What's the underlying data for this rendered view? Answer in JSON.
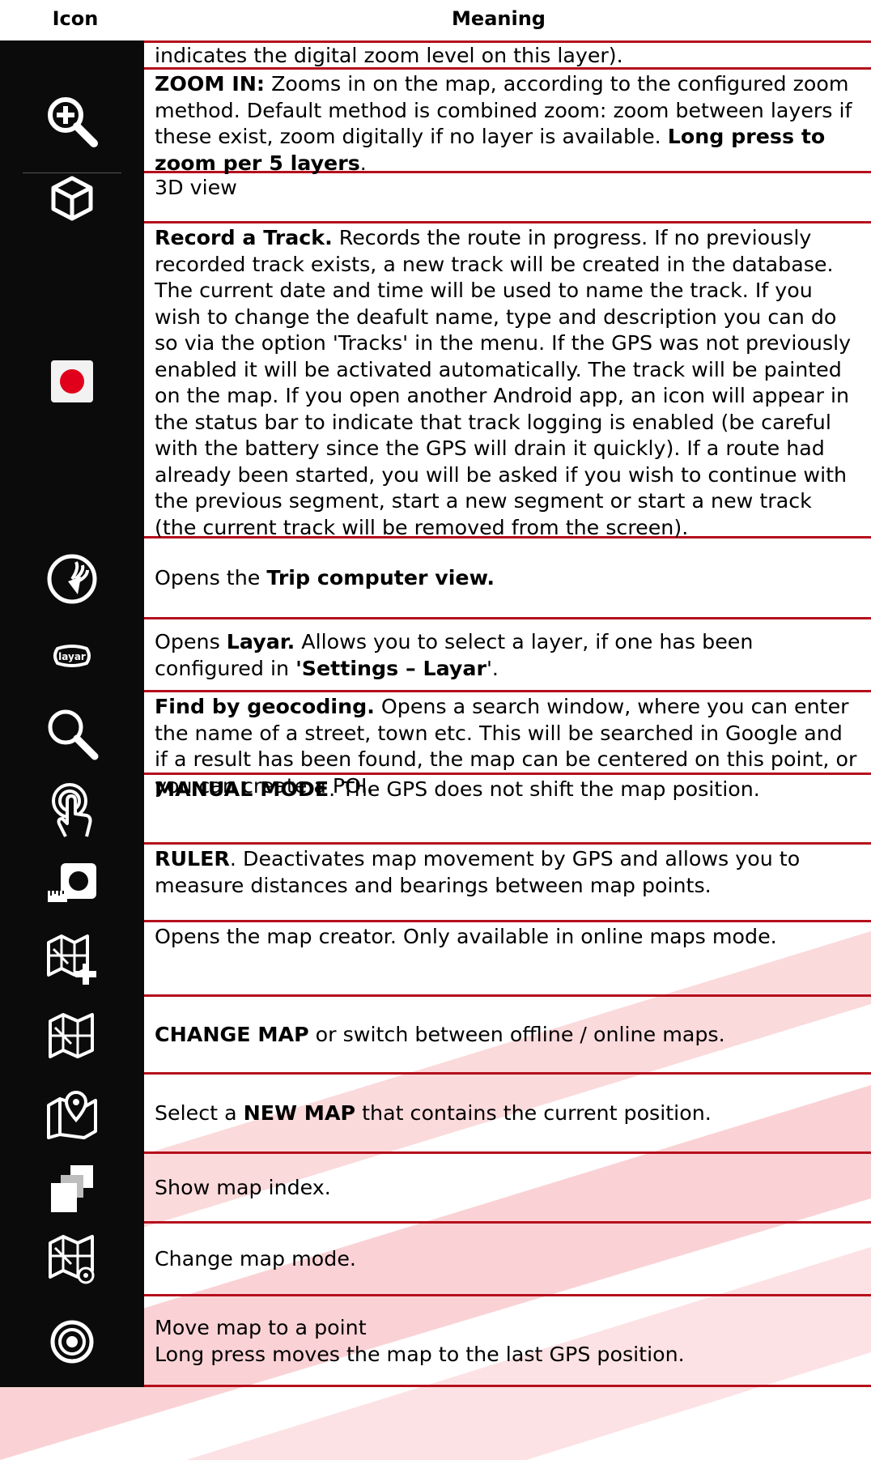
{
  "table": {
    "header": {
      "icon": "Icon",
      "meaning": "Meaning"
    },
    "rows": [
      {
        "icon": "none",
        "parts": [
          {
            "t": "indicates the digital zoom level on this layer)."
          }
        ]
      },
      {
        "icon": "zoom-in-icon",
        "parts": [
          {
            "t": "ZOOM IN:",
            "b": true
          },
          {
            "t": " Zooms in on the map, according to the configured zoom method. Default method is combined zoom: zoom between layers if these exist, zoom digitally if no layer is available. "
          },
          {
            "t": "Long press to zoom per 5 layers",
            "b": true
          },
          {
            "t": "."
          }
        ]
      },
      {
        "icon": "cube-icon",
        "parts": [
          {
            "t": "3D view"
          }
        ]
      },
      {
        "icon": "record-icon",
        "parts": [
          {
            "t": "Record a Track.",
            "b": true
          },
          {
            "t": " Records the route in progress. If no previously recorded track exists, a new track will be created in the database. The current date and time will be used to name the track. If you wish to change the deafult name, type and description you can do so via the option 'Tracks' in the menu. If the GPS was not previously enabled it will be activated automatically. The track will be painted on the map. If you open another Android app, an icon will appear in the status bar to indicate that track logging is enabled (be careful with the battery since the GPS will drain it quickly). If a route had already been started, you will be asked if you wish to continue with the previous segment, start a new segment or start a new track (the current track will be removed from the screen)."
          }
        ]
      },
      {
        "icon": "trip-computer-icon",
        "parts": [
          {
            "t": "Opens the "
          },
          {
            "t": "Trip computer view.",
            "b": true
          }
        ]
      },
      {
        "icon": "layar-icon",
        "parts": [
          {
            "t": "Opens "
          },
          {
            "t": "Layar.",
            "b": true
          },
          {
            "t": " Allows you to select a layer, if one has been configured in "
          },
          {
            "t": "'Settings – Layar",
            "b": true
          },
          {
            "t": "'."
          }
        ]
      },
      {
        "icon": "search-icon",
        "parts": [
          {
            "t": "Find by geocoding.",
            "b": true
          },
          {
            "t": "  Opens a search window, where you can enter the name of a street, town etc. This will be searched in Google and if a result has been found, the map can be centered on this point, or you can create a POI."
          }
        ]
      },
      {
        "icon": "manual-mode-icon",
        "parts": [
          {
            "t": "MANUAL MODE",
            "b": true
          },
          {
            "t": ". The GPS does not shift the map position."
          }
        ]
      },
      {
        "icon": "ruler-icon",
        "parts": [
          {
            "t": "RULER",
            "b": true
          },
          {
            "t": ". Deactivates map movement by GPS and allows you to measure distances and bearings between map points."
          }
        ]
      },
      {
        "icon": "map-creator-icon",
        "parts": [
          {
            "t": "Opens the map creator. Only available in online maps mode."
          }
        ]
      },
      {
        "icon": "change-map-icon",
        "parts": [
          {
            "t": "CHANGE MAP",
            "b": true
          },
          {
            "t": " or switch between offline / online maps."
          }
        ]
      },
      {
        "icon": "new-map-icon",
        "parts": [
          {
            "t": "Select a "
          },
          {
            "t": "NEW MAP",
            "b": true
          },
          {
            "t": " that contains the current position."
          }
        ]
      },
      {
        "icon": "map-index-icon",
        "parts": [
          {
            "t": "Show map index."
          }
        ]
      },
      {
        "icon": "map-mode-icon",
        "parts": [
          {
            "t": "Change map mode."
          }
        ]
      },
      {
        "icon": "target-icon",
        "parts": [
          {
            "t": "Move map to a point"
          },
          {
            "br": true
          },
          {
            "t": "Long press moves the map to the last GPS position."
          }
        ]
      }
    ]
  },
  "colors": {
    "rule": "#b50f1c",
    "icon_bg": "#0b0b0b",
    "watermark": "#e8323f"
  }
}
